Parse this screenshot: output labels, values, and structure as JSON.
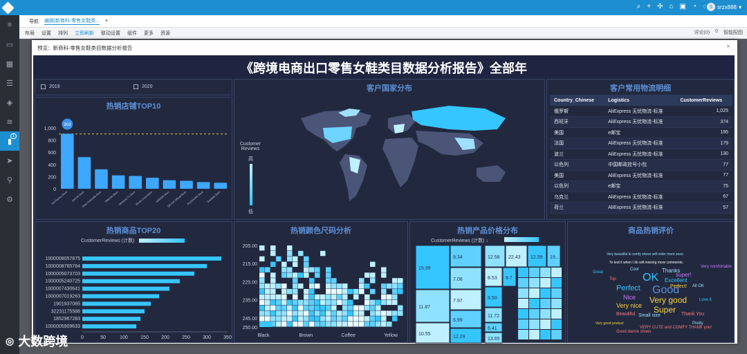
{
  "app": {
    "user": "srzx888"
  },
  "tabs": {
    "nav": "导航",
    "active": "编辑|新商科-零售女鞋类..."
  },
  "toolbar": {
    "items": [
      "布局",
      "设置",
      "排列",
      "立即刷新",
      "联动设置",
      "组件",
      "更多",
      "资源"
    ],
    "right": [
      "评论(0)",
      "0",
      "智能配图"
    ]
  },
  "modal": {
    "title": "预览：新商科-零售女鞋类目数据分析报告",
    "close": "×"
  },
  "dashboard": {
    "title": "《跨境电商出口零售女鞋类目数据分析报告》全部年",
    "year_filters": [
      "2019",
      "2020"
    ]
  },
  "shops": {
    "title": "热销店铺TOP10",
    "chart_data": {
      "type": "bar",
      "categories": [
        "Hot Factory Store",
        "SHIYIN Store",
        "Dear Cinderella Store",
        "YIMEIJIA Store",
        "Women's T1 Store",
        "Shoes Corporation",
        "KIRDOR Store",
        "QEYUE Official Store",
        "DUCEKAFA Store",
        "Sandalia Store"
      ],
      "values": [
        903,
        520,
        320,
        220,
        210,
        180,
        140,
        130,
        110,
        100
      ],
      "highlight": {
        "label": "903",
        "value": 903
      },
      "reference_line": 900,
      "ylim": [
        0,
        1000
      ],
      "yticks": [
        0,
        200,
        400,
        600,
        800,
        "1,000"
      ],
      "color": "#3ea7ff"
    }
  },
  "countries": {
    "title": "客户国家分布",
    "legend_title": "Customer Reviews",
    "legend_high": "高",
    "legend_low": "低"
  },
  "logistics": {
    "title": "客户常用物流明细",
    "headers": [
      "Country_Chinese",
      "Logistics",
      "CustomerReviews"
    ],
    "rows": [
      [
        "俄罗斯",
        "AliExpress 无忧物流-标准",
        "1,025"
      ],
      [
        "西班牙",
        "AliExpress 无忧物流-标准",
        "374"
      ],
      [
        "美国",
        "e邮宝",
        "195"
      ],
      [
        "法国",
        "AliExpress 无忧物流-标准",
        "179"
      ],
      [
        "波兰",
        "AliExpress 无忧物流-标准",
        "130"
      ],
      [
        "以色列",
        "中国邮政挂号小包",
        "77"
      ],
      [
        "美国",
        "AliExpress 无忧物流-标准",
        "77"
      ],
      [
        "以色列",
        "e邮宝",
        "75"
      ],
      [
        "乌克兰",
        "AliExpress 无忧物流-标准",
        "67"
      ],
      [
        "荷兰",
        "AliExpress 无忧物流-标准",
        "57"
      ]
    ]
  },
  "products": {
    "title": "热销商品TOP20",
    "legend": "CustomerReviews (计数)",
    "chart_data": {
      "type": "bar",
      "orientation": "horizontal",
      "categories": [
        "1000008057875",
        "1000008765764",
        "1000005073703",
        "1000005240725",
        "1000007430641",
        "1000007019263",
        "1901937085",
        "32231175588",
        "1852967283",
        "1000005909633"
      ],
      "values": [
        335,
        300,
        270,
        235,
        210,
        185,
        165,
        150,
        140,
        130
      ],
      "xlim": [
        0,
        350
      ],
      "xticks": [
        0,
        50,
        100,
        150,
        200,
        250,
        300,
        350
      ],
      "color": "#36c6ff"
    }
  },
  "colors": {
    "title": "热销颜色尺码分析",
    "chart_data": {
      "type": "heatmap",
      "x_categories": [
        "Black",
        "Brown",
        "Coffee",
        "Yellow"
      ],
      "y_ticks": [
        "205.00",
        "210.00",
        "215.00",
        "220.00",
        "225.00",
        "230.00",
        "235.00",
        "240.00",
        "245.00",
        "250.00"
      ],
      "ylim": [
        205,
        250
      ]
    }
  },
  "prices": {
    "title": "热销产品价格分布",
    "legend": "CustomerReviews (计数) ↓",
    "labels": [
      "15.99",
      "9.34",
      "12.58",
      "22.43",
      "12.59",
      "19...",
      "7.08",
      "8.53",
      "8.7",
      "11.87",
      "7.97",
      "8.50",
      "6.99",
      "11.72",
      "10.55",
      "12.29",
      "6.41",
      "13.65"
    ]
  },
  "reviews": {
    "title": "商品热销评价",
    "words": [
      "OK",
      "Good",
      "Very good",
      "Perfect",
      "Super",
      "Nice",
      "Very nice",
      "Excellent",
      "Thanks",
      "super!",
      "Beautiful",
      "Thank You",
      "Small size",
      "Very good product",
      "Good dance shoes",
      "VERY CUTE and COMFY THANK you!",
      "Very beautiful & comfy shoes will order more soon",
      "To test it when I do will missing more comments.",
      "Perfect!",
      "All OK",
      "Cool",
      "Love it",
      "Very comfortable",
      "Top",
      "Pretty",
      "Great"
    ]
  },
  "watermark": {
    "text": "大数跨境"
  }
}
